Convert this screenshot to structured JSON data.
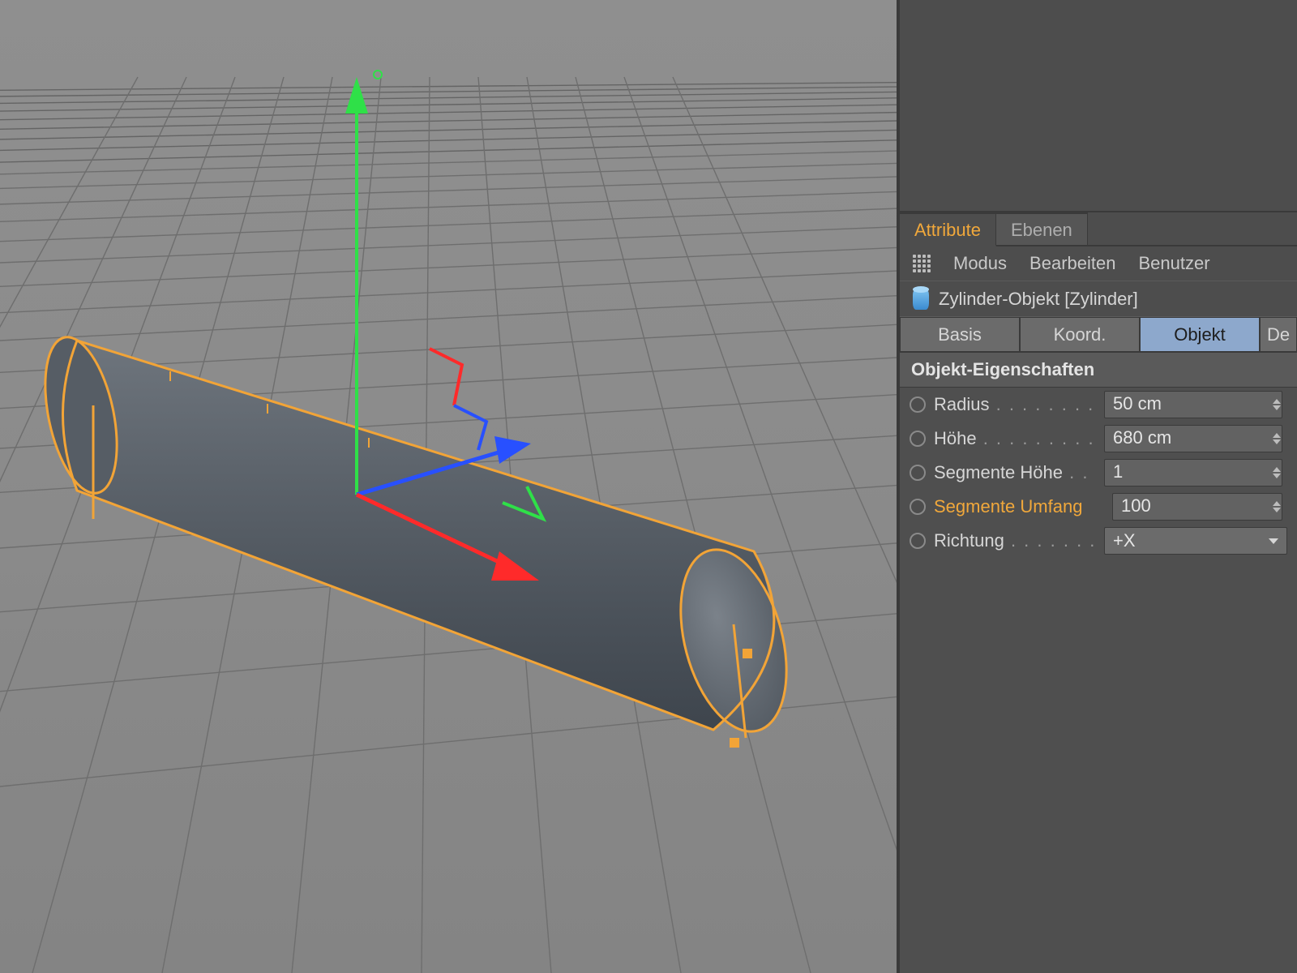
{
  "panel": {
    "tabs": {
      "attribute": "Attribute",
      "ebenen": "Ebenen"
    },
    "menu": {
      "modus": "Modus",
      "bearbeiten": "Bearbeiten",
      "benutzer": "Benutzer"
    },
    "object_header": "Zylinder-Objekt [Zylinder]",
    "subtabs": {
      "basis": "Basis",
      "koord": "Koord.",
      "objekt": "Objekt",
      "cut": "De"
    },
    "section": "Objekt-Eigenschaften",
    "props": {
      "radius_label": "Radius",
      "radius_value": "50 cm",
      "hoehe_label": "Höhe",
      "hoehe_value": "680 cm",
      "seg_hoehe_label": "Segmente Höhe",
      "seg_hoehe_value": "1",
      "seg_umfang_label": "Segmente Umfang",
      "seg_umfang_value": "100",
      "richtung_label": "Richtung",
      "richtung_value": "+X"
    }
  }
}
